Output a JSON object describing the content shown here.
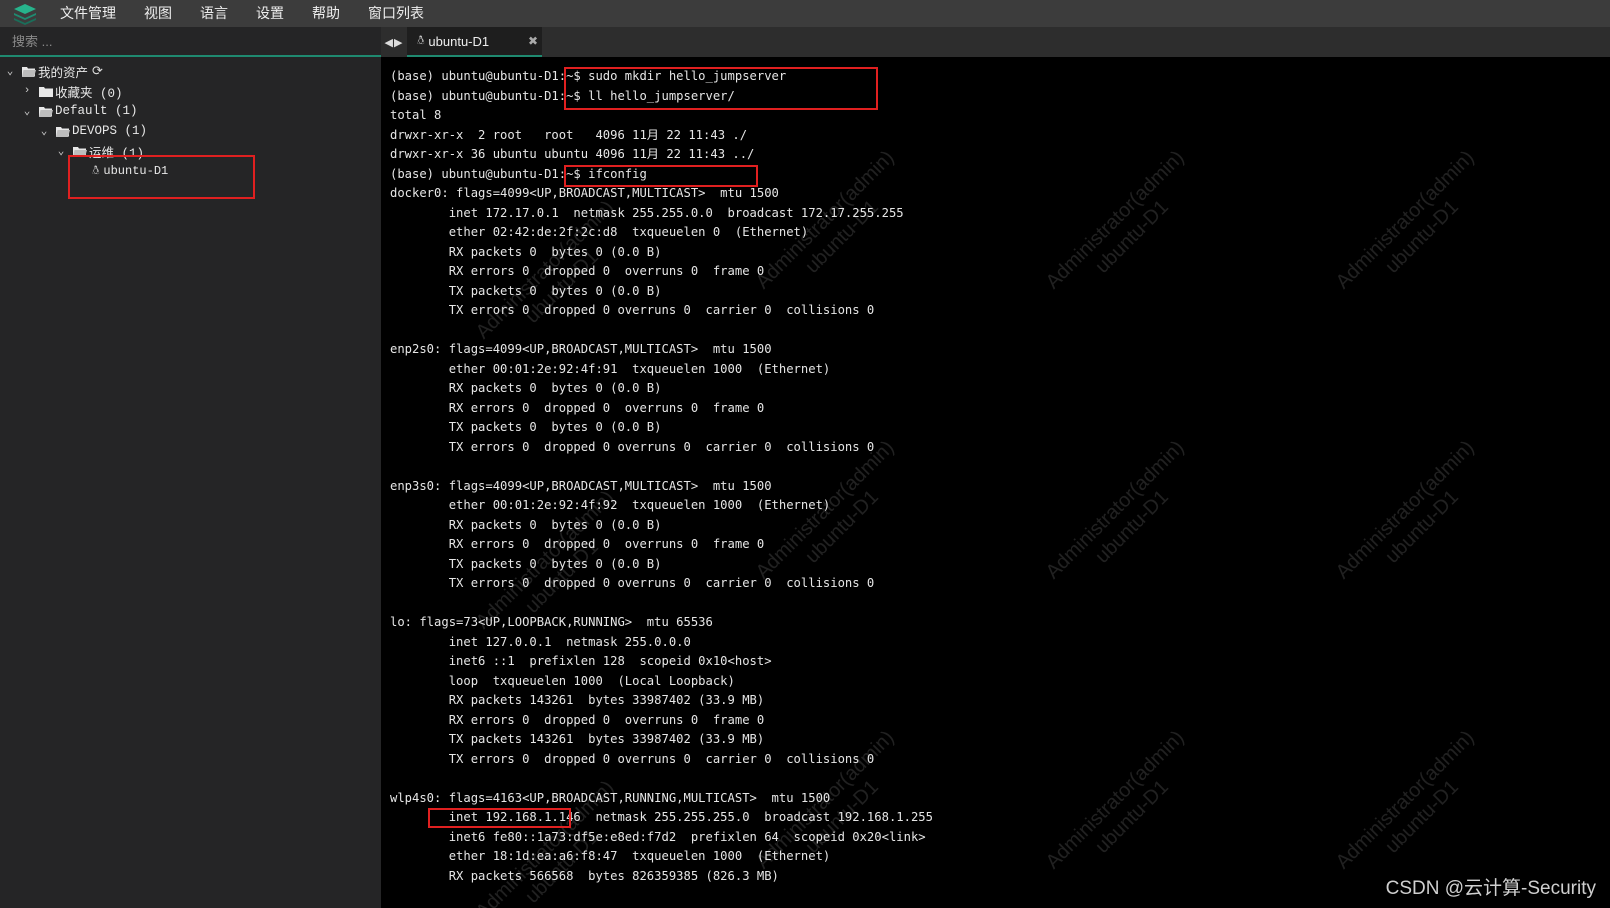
{
  "menu": [
    "文件管理",
    "视图",
    "语言",
    "设置",
    "帮助",
    "窗口列表"
  ],
  "sidebar": {
    "search_placeholder": "搜索 ...",
    "tree": [
      {
        "label": "我的资产",
        "icon": "folder-open-icon"
      },
      {
        "label": "收藏夹 (0)",
        "icon": "folder-icon"
      },
      {
        "label": "Default (1)",
        "icon": "folder-open-icon"
      },
      {
        "label": "DEVOPS (1)",
        "icon": "folder-open-icon"
      },
      {
        "label": "运维 (1)",
        "icon": "folder-open-icon"
      },
      {
        "label": "ubuntu-D1",
        "icon": "linux-icon"
      }
    ]
  },
  "tab": {
    "label": "ubuntu-D1",
    "close": "✖"
  },
  "terminal": {
    "lines": [
      "(base) ubuntu@ubuntu-D1:~$ sudo mkdir hello_jumpserver",
      "(base) ubuntu@ubuntu-D1:~$ ll hello_jumpserver/",
      "total 8",
      "drwxr-xr-x  2 root   root   4096 11月 22 11:43 ./",
      "drwxr-xr-x 36 ubuntu ubuntu 4096 11月 22 11:43 ../",
      "(base) ubuntu@ubuntu-D1:~$ ifconfig",
      "docker0: flags=4099<UP,BROADCAST,MULTICAST>  mtu 1500",
      "        inet 172.17.0.1  netmask 255.255.0.0  broadcast 172.17.255.255",
      "        ether 02:42:de:2f:2c:d8  txqueuelen 0  (Ethernet)",
      "        RX packets 0  bytes 0 (0.0 B)",
      "        RX errors 0  dropped 0  overruns 0  frame 0",
      "        TX packets 0  bytes 0 (0.0 B)",
      "        TX errors 0  dropped 0 overruns 0  carrier 0  collisions 0",
      "",
      "enp2s0: flags=4099<UP,BROADCAST,MULTICAST>  mtu 1500",
      "        ether 00:01:2e:92:4f:91  txqueuelen 1000  (Ethernet)",
      "        RX packets 0  bytes 0 (0.0 B)",
      "        RX errors 0  dropped 0  overruns 0  frame 0",
      "        TX packets 0  bytes 0 (0.0 B)",
      "        TX errors 0  dropped 0 overruns 0  carrier 0  collisions 0",
      "",
      "enp3s0: flags=4099<UP,BROADCAST,MULTICAST>  mtu 1500",
      "        ether 00:01:2e:92:4f:92  txqueuelen 1000  (Ethernet)",
      "        RX packets 0  bytes 0 (0.0 B)",
      "        RX errors 0  dropped 0  overruns 0  frame 0",
      "        TX packets 0  bytes 0 (0.0 B)",
      "        TX errors 0  dropped 0 overruns 0  carrier 0  collisions 0",
      "",
      "lo: flags=73<UP,LOOPBACK,RUNNING>  mtu 65536",
      "        inet 127.0.0.1  netmask 255.0.0.0",
      "        inet6 ::1  prefixlen 128  scopeid 0x10<host>",
      "        loop  txqueuelen 1000  (Local Loopback)",
      "        RX packets 143261  bytes 33987402 (33.9 MB)",
      "        RX errors 0  dropped 0  overruns 0  frame 0",
      "        TX packets 143261  bytes 33987402 (33.9 MB)",
      "        TX errors 0  dropped 0 overruns 0  carrier 0  collisions 0",
      "",
      "wlp4s0: flags=4163<UP,BROADCAST,RUNNING,MULTICAST>  mtu 1500",
      "        inet 192.168.1.146  netmask 255.255.255.0  broadcast 192.168.1.255",
      "        inet6 fe80::1a73:df5e:e8ed:f7d2  prefixlen 64  scopeid 0x20<link>",
      "        ether 18:1d:ea:a6:f8:47  txqueuelen 1000  (Ethernet)",
      "        RX packets 566568  bytes 826359385 (826.3 MB)"
    ]
  },
  "watermark": "Administrator(admin)\nubuntu-D1",
  "credit": "CSDN @云计算-Security",
  "colors": {
    "accent": "#1f8a70",
    "highlight_box": "#e02020",
    "terminal_bg": "#000000"
  }
}
